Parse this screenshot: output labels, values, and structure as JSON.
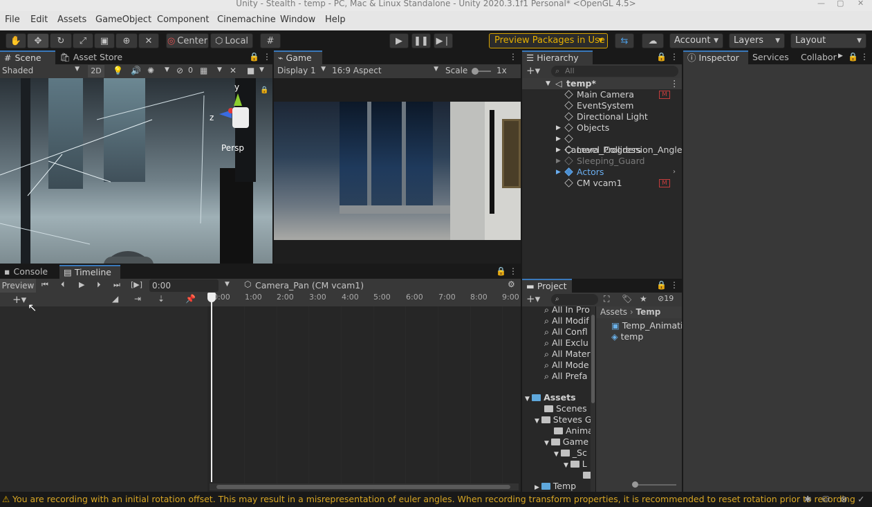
{
  "window": {
    "title": "Unity - Stealth - temp - PC, Mac & Linux Standalone - Unity 2020.3.1f1 Personal* <OpenGL 4.5>"
  },
  "menu": [
    "File",
    "Edit",
    "Assets",
    "GameObject",
    "Component",
    "Cinemachine",
    "Window",
    "Help"
  ],
  "toolbar": {
    "pivot": "Center",
    "space": "Local",
    "preview_packages": "Preview Packages in Use",
    "account": "Account",
    "layers": "Layers",
    "layout": "Layout"
  },
  "scene_panel": {
    "tabs": [
      "Scene",
      "Asset Store"
    ],
    "shading": "Shaded",
    "mode_2d": "2D",
    "hidden_count": "0",
    "gizmo_y": "y",
    "gizmo_z": "z",
    "persp": "Persp"
  },
  "game_panel": {
    "tab": "Game",
    "display": "Display 1",
    "aspect": "16:9 Aspect",
    "scale_label": "Scale",
    "scale_value": "1x"
  },
  "hierarchy": {
    "tab": "Hierarchy",
    "search_placeholder": "All",
    "scene": "temp*",
    "items": [
      {
        "label": "Main Camera",
        "expandable": false,
        "badge": "M"
      },
      {
        "label": "EventSystem",
        "expandable": false
      },
      {
        "label": "Directional Light",
        "expandable": false
      },
      {
        "label": "Objects",
        "expandable": true
      },
      {
        "label": "Camera_Progression_Angle",
        "expandable": true
      },
      {
        "label": "Level_Colliders",
        "expandable": true
      },
      {
        "label": "Sleeping_Guard",
        "expandable": true
      },
      {
        "label": "Actors",
        "expandable": true
      },
      {
        "label": "CM vcam1",
        "expandable": false,
        "badge": "M"
      }
    ]
  },
  "inspector": {
    "tabs": [
      "Inspector",
      "Services",
      "Collabor"
    ]
  },
  "timeline": {
    "tabs": [
      "Console",
      "Timeline"
    ],
    "preview": "Preview",
    "time": "0:00",
    "asset": "Camera_Pan (CM vcam1)",
    "ruler": [
      "0:00",
      "1:00",
      "2:00",
      "3:00",
      "4:00",
      "5:00",
      "6:00",
      "7:00",
      "8:00",
      "9:00"
    ]
  },
  "project": {
    "tab": "Project",
    "hidden_count": "19",
    "favorites": [
      "All In Pro",
      "All Modif",
      "All Confl",
      "All Exclu",
      "All Mater",
      "All Mode",
      "All Prefa"
    ],
    "tree": [
      {
        "label": "Assets",
        "depth": 0,
        "bold": true
      },
      {
        "label": "Scenes",
        "depth": 1
      },
      {
        "label": "Steves G",
        "depth": 1
      },
      {
        "label": "Anima",
        "depth": 2
      },
      {
        "label": "Game",
        "depth": 2
      },
      {
        "label": "_Sc",
        "depth": 3
      },
      {
        "label": "L",
        "depth": 4
      },
      {
        "label": "",
        "depth": 5
      },
      {
        "label": "Temp",
        "depth": 1
      }
    ],
    "breadcrumb": [
      "Assets",
      "Temp"
    ],
    "files": [
      "Temp_Animatio",
      "temp"
    ]
  },
  "status": {
    "message": "You are recording with an initial rotation offset. This may result in a misrepresentation of euler angles. When recording transform properties, it is recommended to reset rotation prior to recording"
  }
}
